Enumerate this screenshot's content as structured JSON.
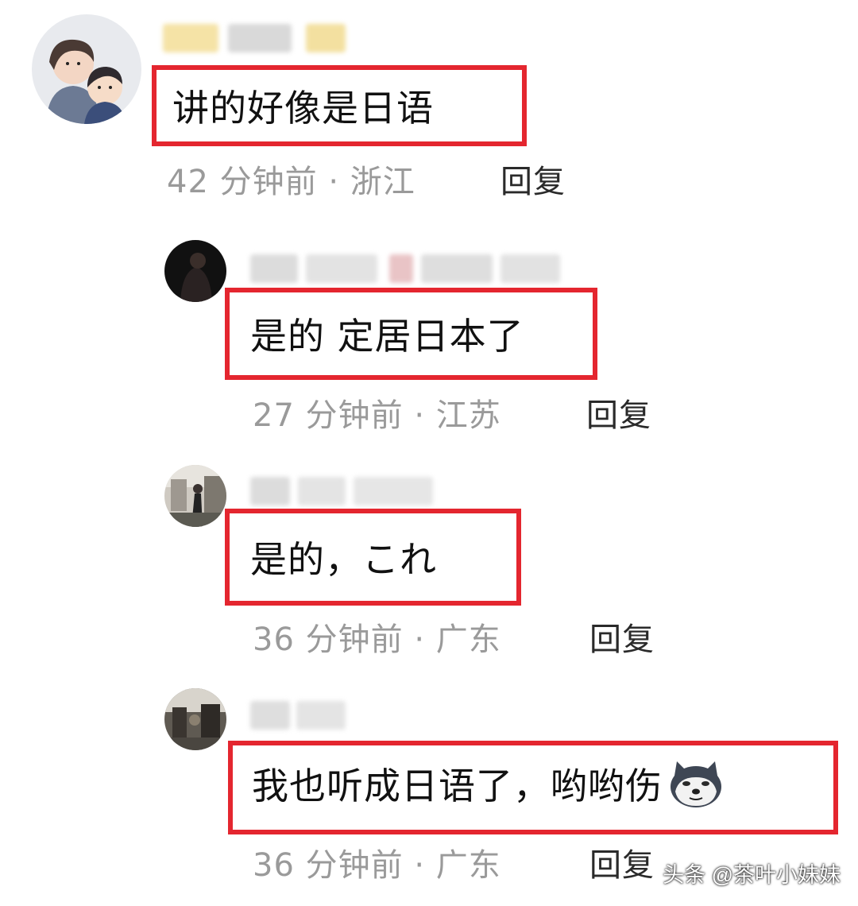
{
  "comments": [
    {
      "text": "讲的好像是日语",
      "time": "42 分钟前",
      "location": "浙江",
      "reply_label": "回复"
    },
    {
      "text": "是的 定居日本了",
      "time": "27 分钟前",
      "location": "江苏",
      "reply_label": "回复"
    },
    {
      "text": "是的，これ",
      "time": "36 分钟前",
      "location": "广东",
      "reply_label": "回复"
    },
    {
      "text": "我也听成日语了，哟哟伤",
      "emoji": "doge-icon",
      "time": "36 分钟前",
      "location": "广东",
      "reply_label": "回复"
    }
  ],
  "separator": "·",
  "watermark": "头条 @茶叶小妹妹",
  "colors": {
    "highlight_border": "#e4262f",
    "meta_text": "#9a9a9a",
    "reply_text": "#2a2a2a"
  }
}
